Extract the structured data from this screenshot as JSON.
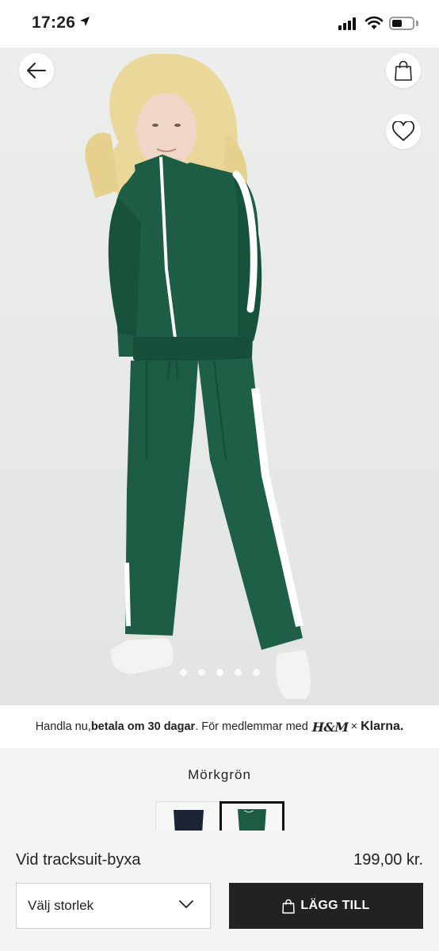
{
  "status_bar": {
    "time": "17:26"
  },
  "banner": {
    "text_start": "Handla nu, ",
    "text_bold": "betala om 30 dagar",
    "text_end": ". För medlemmar med ",
    "hm": "H&M",
    "times": "×",
    "klarna": "Klarna."
  },
  "gallery": {
    "image_count": 5,
    "active_index": 2
  },
  "color": {
    "name": "Mörkgrön",
    "swatches": [
      "navy",
      "dark-green"
    ],
    "selected_index": 1
  },
  "product": {
    "name": "Vid tracksuit-byxa",
    "price": "199,00 kr."
  },
  "size_select": {
    "label": "Välj storlek"
  },
  "add_to_cart": {
    "label": "LÄGG TILL"
  },
  "colors": {
    "garment_green": "#1c5c43",
    "button_dark": "#222222"
  }
}
